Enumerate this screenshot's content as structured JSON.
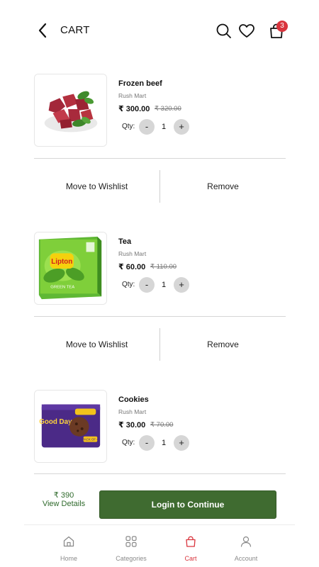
{
  "header": {
    "title": "CART",
    "back_icon": "chevron-left-icon",
    "search_icon": "search-icon",
    "wishlist_icon": "heart-icon",
    "bag_icon": "shopping-bag-icon",
    "bag_count": "3"
  },
  "items": [
    {
      "name": "Frozen beef",
      "seller": "Rush Mart",
      "price": "₹ 300.00",
      "mrp": "₹ 320.00",
      "qty_label": "Qty:",
      "qty": "1",
      "minus": "-",
      "plus": "+",
      "move_to_wishlist": "Move to Wishlist",
      "remove": "Remove"
    },
    {
      "name": "Tea",
      "seller": "Rush Mart",
      "price": "₹ 60.00",
      "mrp": "₹ 110.00",
      "qty_label": "Qty:",
      "qty": "1",
      "minus": "-",
      "plus": "+",
      "move_to_wishlist": "Move to Wishlist",
      "remove": "Remove",
      "pack_text": "GREEN TEA",
      "logo": "Lipton"
    },
    {
      "name": "Cookies",
      "seller": "Rush Mart",
      "price": "₹ 30.00",
      "mrp": "₹ 70.00",
      "qty_label": "Qty:",
      "qty": "1",
      "minus": "-",
      "plus": "+",
      "pack_logo": "Good Day",
      "pack_badge": "PACK OF 4"
    }
  ],
  "checkout": {
    "total": "₹ 390",
    "view_details": "View Details",
    "button_label": "Login to Continue"
  },
  "nav": {
    "home": "Home",
    "categories": "Categories",
    "cart": "Cart",
    "account": "Account",
    "active": "Cart"
  },
  "colors": {
    "primary_green": "#3f6b30",
    "link_green": "#2f6a2c",
    "badge_red": "#d9343d",
    "active_nav": "#d9343d"
  }
}
